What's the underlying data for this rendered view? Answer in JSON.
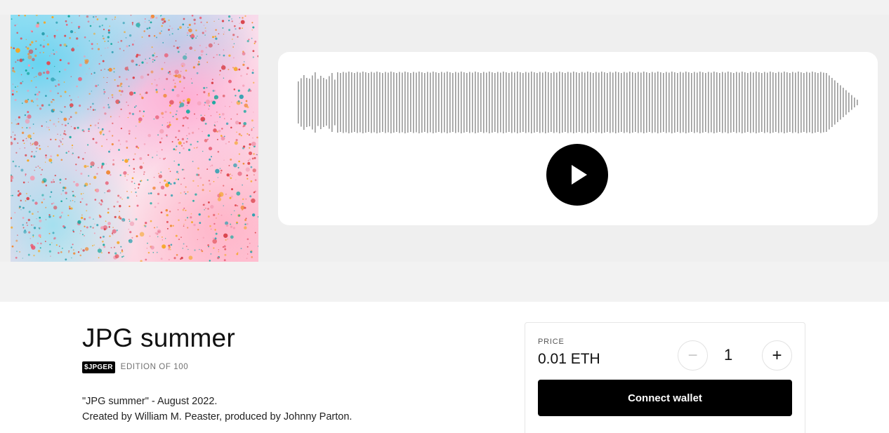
{
  "artwork": {
    "alt": "JPG summer cover art"
  },
  "player": {
    "play_icon": "play-icon",
    "waveform_color": "#9a9a9a"
  },
  "release": {
    "title": "JPG summer",
    "ticker": "$JPGER",
    "edition": "EDITION OF 100",
    "description_lines": [
      "\"JPG summer\" - August 2022.",
      "Created by William M. Peaster, produced by Johnny Parton."
    ]
  },
  "purchase": {
    "price_label": "PRICE",
    "price_value": "0.01 ETH",
    "minus_symbol": "−",
    "quantity": "1",
    "plus_symbol": "+",
    "connect_label": "Connect wallet"
  },
  "colors": {
    "page_background": "#f2f2f2",
    "button_black": "#000000",
    "edition_gray": "#707070"
  }
}
